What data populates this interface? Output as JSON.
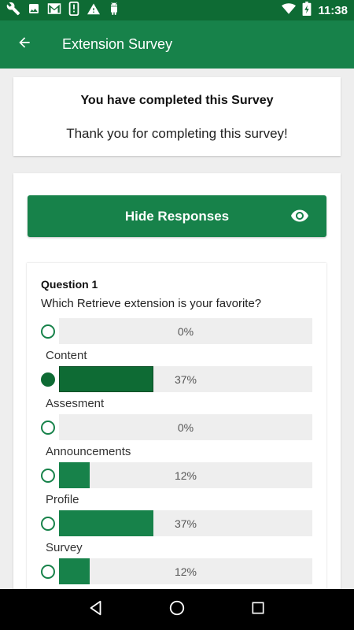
{
  "status_bar": {
    "time": "11:38",
    "icons": [
      "wrench-icon",
      "image-icon",
      "gmail-icon",
      "phone-alert-icon",
      "warning-icon",
      "android-icon",
      "wifi-icon",
      "battery-charging-icon"
    ]
  },
  "app_bar": {
    "title": "Extension Survey",
    "back_icon": "arrow-left-icon"
  },
  "completion": {
    "title": "You have completed this Survey",
    "message": "Thank you for completing this survey!"
  },
  "responses": {
    "button_label": "Hide Responses",
    "button_icon": "eye-icon"
  },
  "question": {
    "number": "Question 1",
    "text": "Which Retrieve extension is your favorite?",
    "options": [
      {
        "label": "",
        "percent": "0%",
        "value": 0,
        "selected": false
      },
      {
        "label": "Content",
        "percent": "37%",
        "value": 37,
        "selected": true
      },
      {
        "label": "Assesment",
        "percent": "0%",
        "value": 0,
        "selected": false
      },
      {
        "label": "Announcements",
        "percent": "12%",
        "value": 12,
        "selected": false
      },
      {
        "label": "Profile",
        "percent": "37%",
        "value": 37,
        "selected": false
      },
      {
        "label": "Survey",
        "percent": "12%",
        "value": 12,
        "selected": false
      }
    ]
  },
  "nav": {
    "back_icon": "nav-back-icon",
    "home_icon": "nav-home-icon",
    "recents_icon": "nav-recents-icon"
  },
  "colors": {
    "primary": "#17824a",
    "primary_dark": "#0e6b34",
    "track": "#eeeeee"
  }
}
